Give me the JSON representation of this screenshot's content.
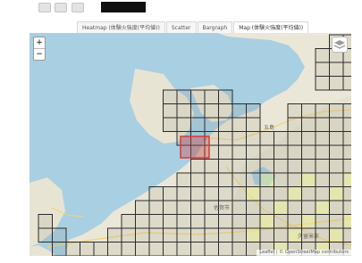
{
  "tabs": [
    {
      "label": "Heatmap (体験火強度(平均値))",
      "active": false
    },
    {
      "label": "Scatter",
      "active": false
    },
    {
      "label": "Bargraph",
      "active": false
    },
    {
      "label": "Map (体験火強度(平均値))",
      "active": true
    }
  ],
  "map": {
    "zoom_in": "+",
    "zoom_out": "−",
    "layers_icon": "layers-icon",
    "labels": [
      "五島",
      "佐賀市",
      "久留米市"
    ],
    "attribution": "Leaflet | © OpenStreetMap contributors",
    "colors": {
      "sea": "#a9cfe2",
      "land": "#ebe7d8",
      "cell_fill": "#e4e884",
      "highlight": "#d83a3a"
    }
  }
}
